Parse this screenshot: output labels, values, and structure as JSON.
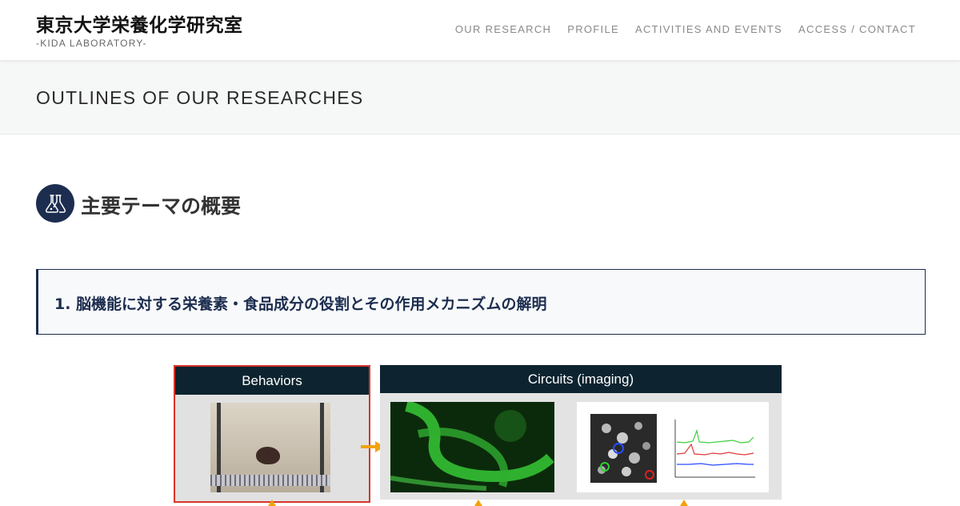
{
  "header": {
    "site_title": "東京大学栄養化学研究室",
    "site_subtitle": "-KIDA LABORATORY-",
    "nav": [
      {
        "label": "OUR RESEARCH"
      },
      {
        "label": "PROFILE"
      },
      {
        "label": "ACTIVITIES AND EVENTS"
      },
      {
        "label": "ACCESS / CONTACT"
      }
    ]
  },
  "page": {
    "title": "OUTLINES OF OUR RESEARCHES"
  },
  "section": {
    "icon": "flask-icon",
    "heading": "主要テーマの概要"
  },
  "topic": {
    "text": "1. 脳機能に対する栄養素・食品成分の役割とその作用メカニズムの解明"
  },
  "figure": {
    "panel_behaviors_title": "Behaviors",
    "panel_circuits_title": "Circuits (imaging)"
  },
  "colors": {
    "accent_navy": "#1c2d4f",
    "panel_header": "#0d2430",
    "behaviors_border": "#d9342b",
    "arrow_orange": "#f1a30e",
    "neuron_green": "#3ecf3e"
  }
}
